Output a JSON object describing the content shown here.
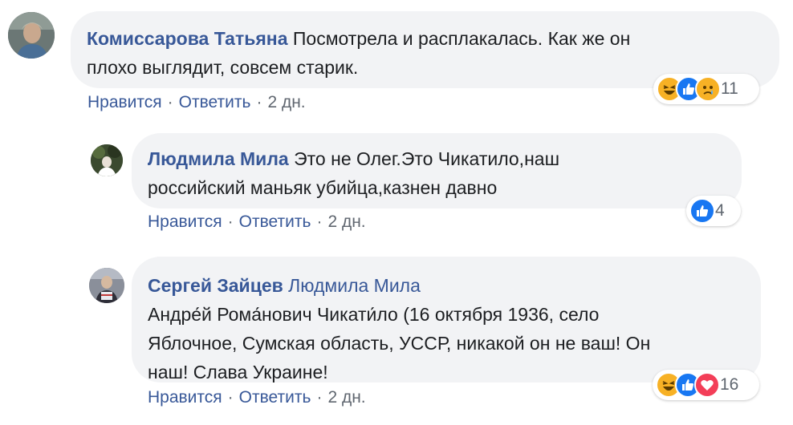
{
  "colors": {
    "link": "#385898",
    "bubble": "#f2f3f5",
    "like": "#1877f2",
    "haha": "#f7b125",
    "love": "#f33e58"
  },
  "comments": [
    {
      "author": "Комиссарова Татьяна",
      "text_line1": "Посмотрела и расплакалась. Как же он",
      "text_line2": "плохо выглядит, совсем старик.",
      "like_label": "Нравится",
      "reply_label": "Ответить",
      "time": "2 дн.",
      "reactions": [
        "haha-icon",
        "like-icon",
        "sad-icon"
      ],
      "reaction_count": "11"
    },
    {
      "author": "Людмила Мила",
      "text_line1": "Это не Олег.Это Чикатило,наш",
      "text_line2": "российский маньяк убийца,казнен давно",
      "like_label": "Нравится",
      "reply_label": "Ответить",
      "time": "2 дн.",
      "reactions": [
        "like-icon"
      ],
      "reaction_count": "4"
    },
    {
      "author": "Сергей Зайцев",
      "mention": "Людмила Мила",
      "text_line1": "Андре́й Рома́нович Чикати́ло (16 октября 1936, село",
      "text_line2": "Яблочное, Сумская область, УССР, никакой он не ваш! Он",
      "text_line3": "наш! Слава Украине!",
      "like_label": "Нравится",
      "reply_label": "Ответить",
      "time": "2 дн.",
      "reactions": [
        "haha-icon",
        "like-icon",
        "love-icon"
      ],
      "reaction_count": "16"
    }
  ]
}
